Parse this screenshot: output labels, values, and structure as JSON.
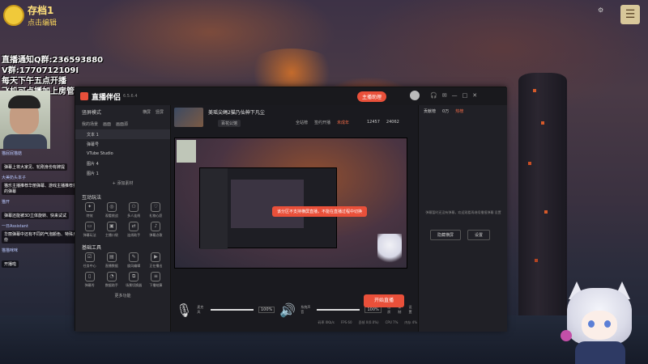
{
  "overlay": {
    "save_title": "存档1",
    "save_subtitle": "点击编辑",
    "notice_lines": [
      "直播通知Q群:236593880",
      "V群:1770712109I",
      "每天下午五点开播",
      "飞机可点播加上房管"
    ]
  },
  "chat": [
    {
      "user": "猫屁屁猫菇",
      "text": "弹幕上将大家见、轮刚身份有牌提"
    },
    {
      "user": "大美奶头本子",
      "text": "猫乐主播推荐华丽弹幕、游戏主播推荐我的弹幕"
    },
    {
      "user": "猫开",
      "text": "弹幕还能被3D立体旋转、快来试试"
    },
    {
      "user": "一日Assistant",
      "text": "华丽弹幕中还有不同的气泡颜色、特殊身份"
    },
    {
      "user": "猫猫咪咪",
      "text": "开播啦"
    }
  ],
  "app": {
    "title": "直播伴侣",
    "version": "6.5.6.4",
    "top_live_button": "主播助理",
    "scenes_header": "竖屏模式",
    "scene_tabs_right": [
      "横屏",
      "竖屏"
    ],
    "source_tabs": [
      "我的场景",
      "画面",
      "画面源"
    ],
    "sources": [
      "文本 1",
      "弹幕号",
      "VTube Studio",
      "图片 4",
      "图片 1"
    ],
    "add_source": "+ 添加素材",
    "interactive_title": "互动玩法",
    "interactive_tools": [
      "特效",
      "观看挑战",
      "多人连线",
      "礼物心愿",
      "弹幕玩法",
      "主播口袋",
      "连线助手",
      "弹幕点歌"
    ],
    "basic_title": "基础工具",
    "basic_tools": [
      "任务中心",
      "直播数据",
      "旋风编辑",
      "正在播出",
      "弹幕秀",
      "数据助手",
      "场景切换器",
      "下播结算"
    ],
    "more_functions": "更多功能",
    "room_title": "美瑶尖绳2猫乃仙神下凡尘",
    "room_category": "百花公馆",
    "room_meta": [
      "全站榜",
      "签约开播",
      "未成年"
    ],
    "room_stats": [
      "12457",
      "24062"
    ],
    "toast": "该分区不支持横屏直播，不能在直播过程中切换",
    "mic_label": "麦克风",
    "sys_label": "系统声音",
    "mic_vol": "100%",
    "sys_vol": "100%",
    "mini_icons": [
      "画质",
      "录制",
      "设置"
    ],
    "start_live": "开始直播",
    "status_items": [
      "码率 0Kb/s",
      "FPS 60",
      "丢帧 0(0.0%)",
      "CPU 7%",
      "内存 4%"
    ],
    "right_tabs": [
      "贡献榜",
      "0万",
      "热榜"
    ],
    "right_empty": "弹幕暂时还没有弹幕，欢迎观看再继续播报弹幕 设置",
    "right_empty_link": "设置",
    "right_buttons": [
      "隐藏横屏",
      "设置"
    ]
  }
}
